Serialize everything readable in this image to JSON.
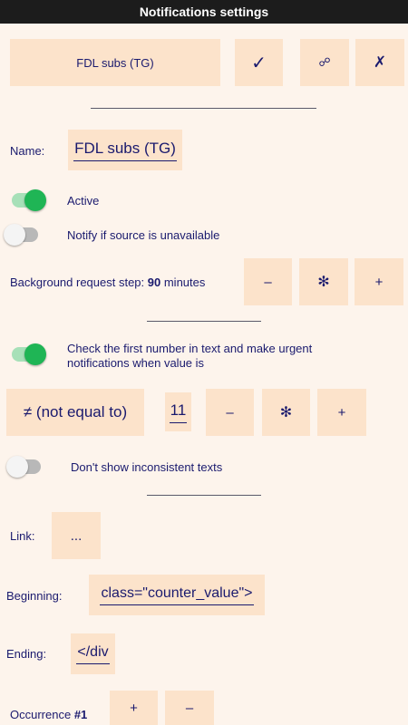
{
  "app": {
    "title": "Notifications settings"
  },
  "header_row": {
    "name_button": "FDL subs (TG)",
    "confirm_icon": "✓",
    "link_icon": "☍",
    "close_icon": "✗"
  },
  "name": {
    "label": "Name:",
    "value": "FDL subs (TG)"
  },
  "active": {
    "label": "Active",
    "enabled": true
  },
  "notify_unavailable": {
    "label": "Notify if source is unavailable",
    "enabled": false
  },
  "background_step": {
    "label_prefix": "Background request step: ",
    "value": "90",
    "label_suffix": " minutes",
    "minus": "–",
    "reset": "✻",
    "plus": "+"
  },
  "check_number": {
    "label_line1": "Check the first number in text and make urgent",
    "label_line2": "notifications when value is",
    "enabled": true
  },
  "condition": {
    "operator": "≠ (not equal to)",
    "value": "11",
    "minus": "–",
    "reset": "✻",
    "plus": "+"
  },
  "inconsistent": {
    "label": "Don't show inconsistent texts",
    "enabled": false
  },
  "link": {
    "label": "Link:",
    "value": "..."
  },
  "beginning": {
    "label": "Beginning:",
    "value": "class=\"counter_value\">"
  },
  "ending": {
    "label": "Ending:",
    "value": "</div"
  },
  "occurrence": {
    "label_prefix": "Occurrence ",
    "number": "#1",
    "plus": "+",
    "minus": "–"
  },
  "colors": {
    "background": "#fdf4ec",
    "button": "#fce3cb",
    "text": "#1a1a6e",
    "toggle_on": "#1fb555",
    "titlebar": "#1c1c1c"
  }
}
